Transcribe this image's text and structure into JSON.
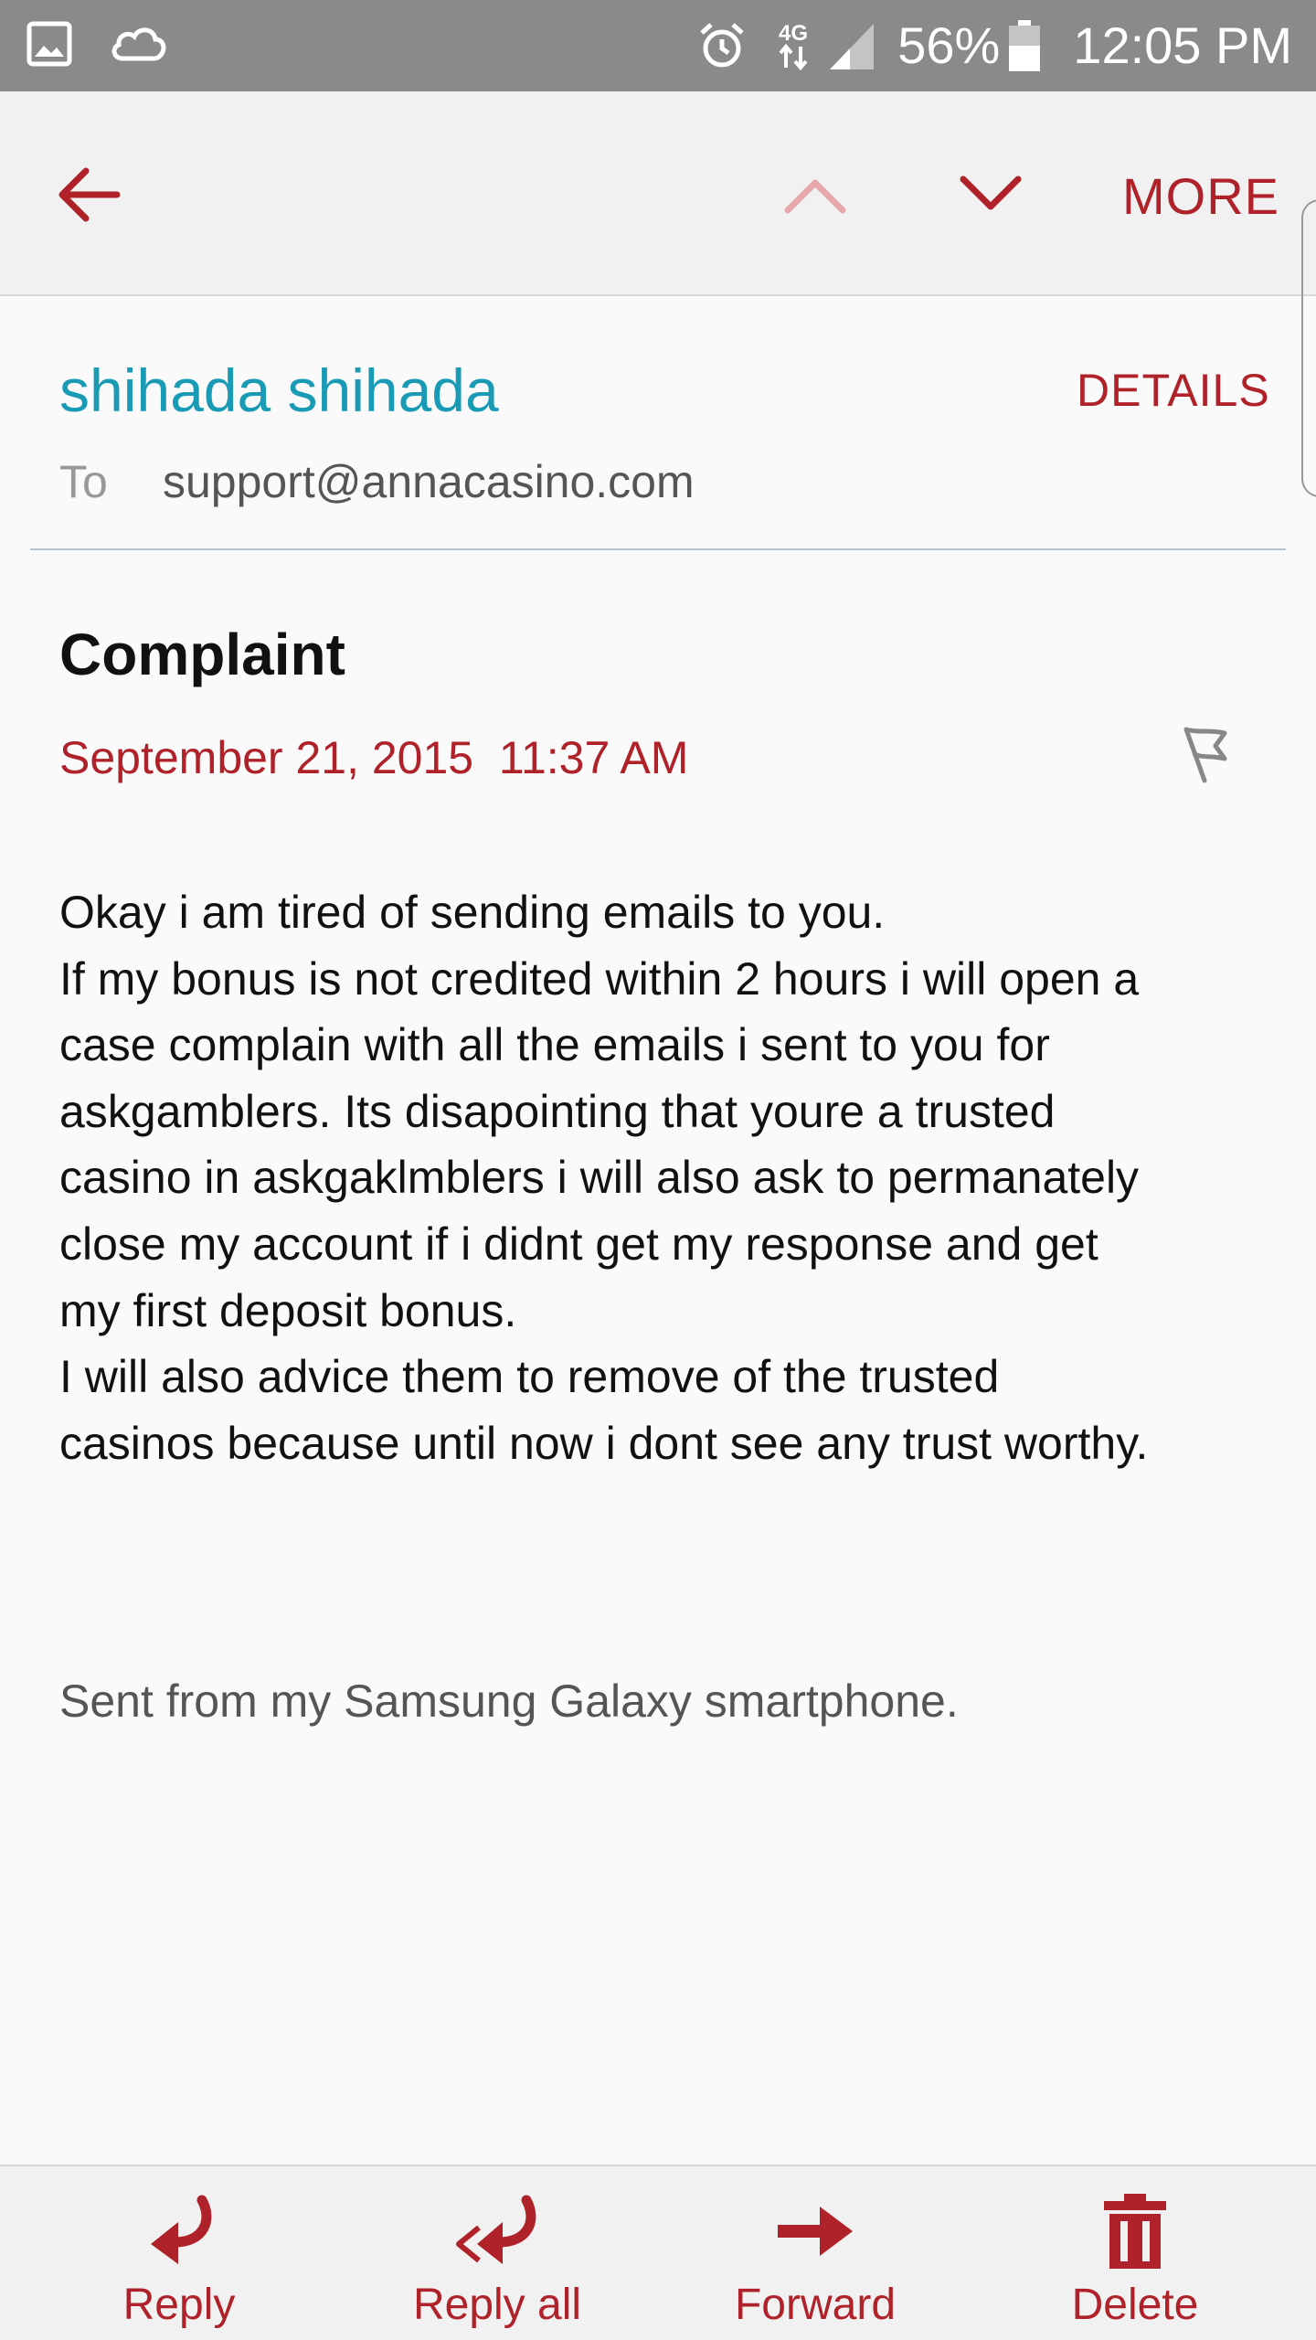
{
  "status_bar": {
    "battery_percent": "56%",
    "time": "12:05 PM",
    "network": "4G",
    "icons": [
      "gallery-icon",
      "cloud-icon",
      "alarm-icon",
      "network-4g-icon",
      "signal-icon",
      "battery-icon"
    ]
  },
  "toolbar": {
    "more_label": "MORE",
    "icons": [
      "back-arrow-icon",
      "chevron-up-icon",
      "chevron-down-icon"
    ]
  },
  "email": {
    "sender_name": "shihada shihada",
    "details_label": "DETAILS",
    "to_label": "To",
    "to_address": "support@annacasino.com",
    "subject": "Complaint",
    "date": "September 21, 2015  11:37 AM",
    "body_lines": [
      "Okay i am tired of sending emails to you.",
      "If my bonus is not credited within 2 hours i will open a",
      "case complain with all the emails i sent to you for",
      "askgamblers. Its disapointing that youre a trusted",
      "casino in askgaklmblers i will also ask to permanately",
      "close my account if i didnt get my response and get",
      "my first deposit bonus.",
      "I will also advice them to remove of the trusted",
      "casinos because until now i dont see any trust worthy."
    ],
    "signature": "Sent from my Samsung Galaxy smartphone."
  },
  "actions": {
    "reply_label": "Reply",
    "reply_all_label": "Reply all",
    "forward_label": "Forward",
    "delete_label": "Delete"
  },
  "colors": {
    "accent_red": "#b0222a",
    "sender_teal": "#1a9bb5",
    "status_bar_gray": "#8a8a8a"
  }
}
